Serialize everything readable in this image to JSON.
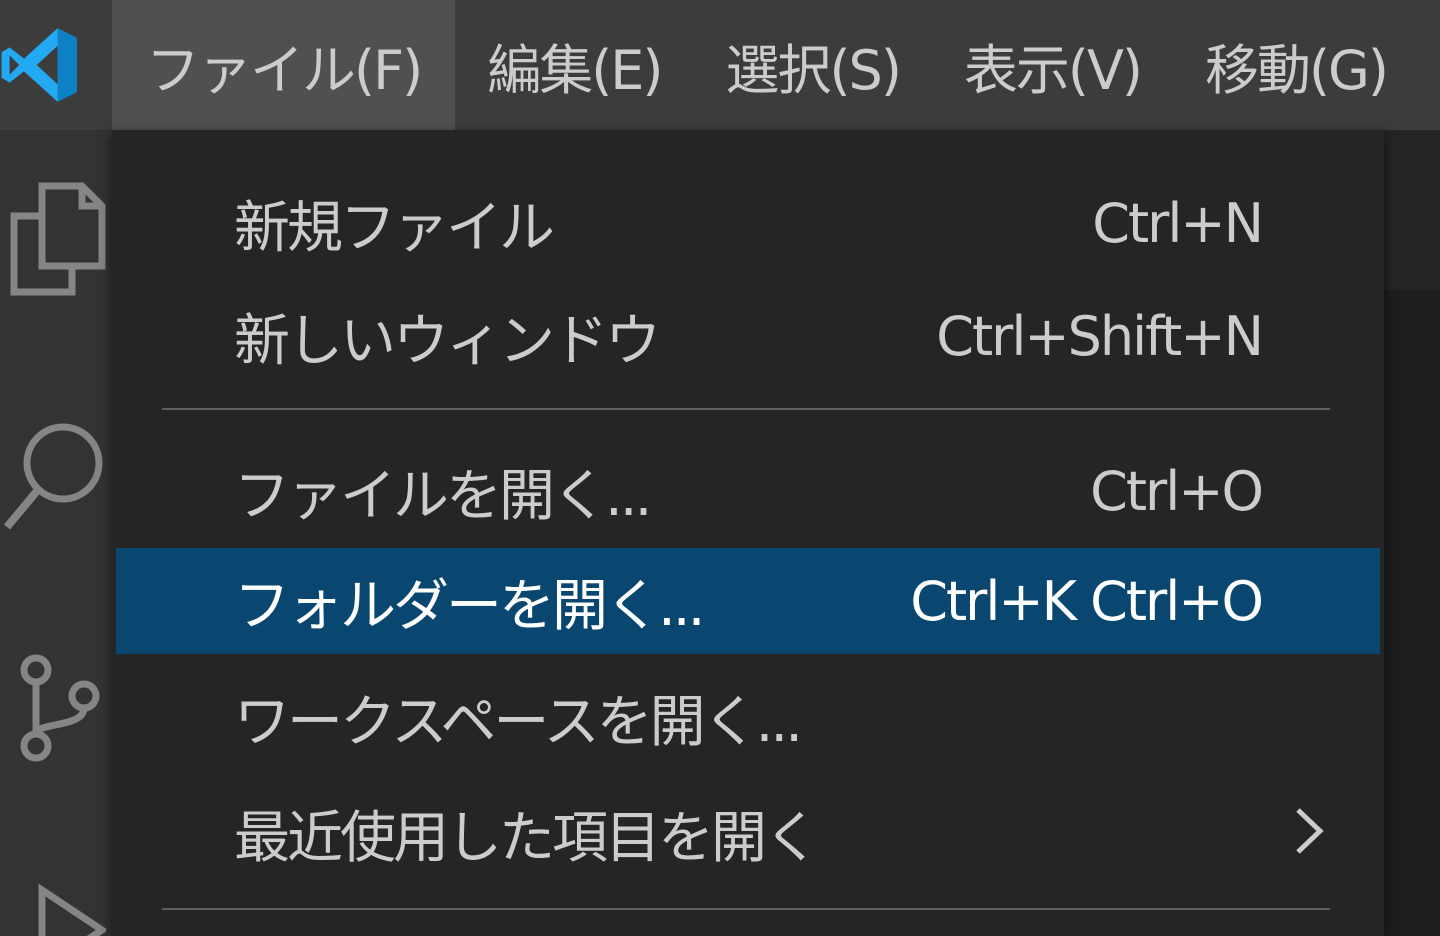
{
  "menubar": {
    "items": [
      {
        "label": "ファイル(F)",
        "active": true
      },
      {
        "label": "編集(E)"
      },
      {
        "label": "選択(S)"
      },
      {
        "label": "表示(V)"
      },
      {
        "label": "移動(G)"
      }
    ]
  },
  "file_menu": {
    "new_file": {
      "label": "新規ファイル",
      "shortcut": "Ctrl+N"
    },
    "new_window": {
      "label": "新しいウィンドウ",
      "shortcut": "Ctrl+Shift+N"
    },
    "open_file": {
      "label": "ファイルを開く...",
      "shortcut": "Ctrl+O"
    },
    "open_folder": {
      "label": "フォルダーを開く...",
      "shortcut": "Ctrl+K Ctrl+O"
    },
    "open_workspace": {
      "label": "ワークスペースを開く..."
    },
    "open_recent": {
      "label": "最近使用した項目を開く"
    }
  },
  "activitybar": {
    "icons": [
      "explorer-icon",
      "search-icon",
      "source-control-icon",
      "run-debug-icon"
    ]
  },
  "colors": {
    "accent": "#094771",
    "logo_blue": "#23a9f2",
    "menubar_bg": "#3c3c3c",
    "menu_bg": "#252526",
    "activitybar_bg": "#333333"
  }
}
